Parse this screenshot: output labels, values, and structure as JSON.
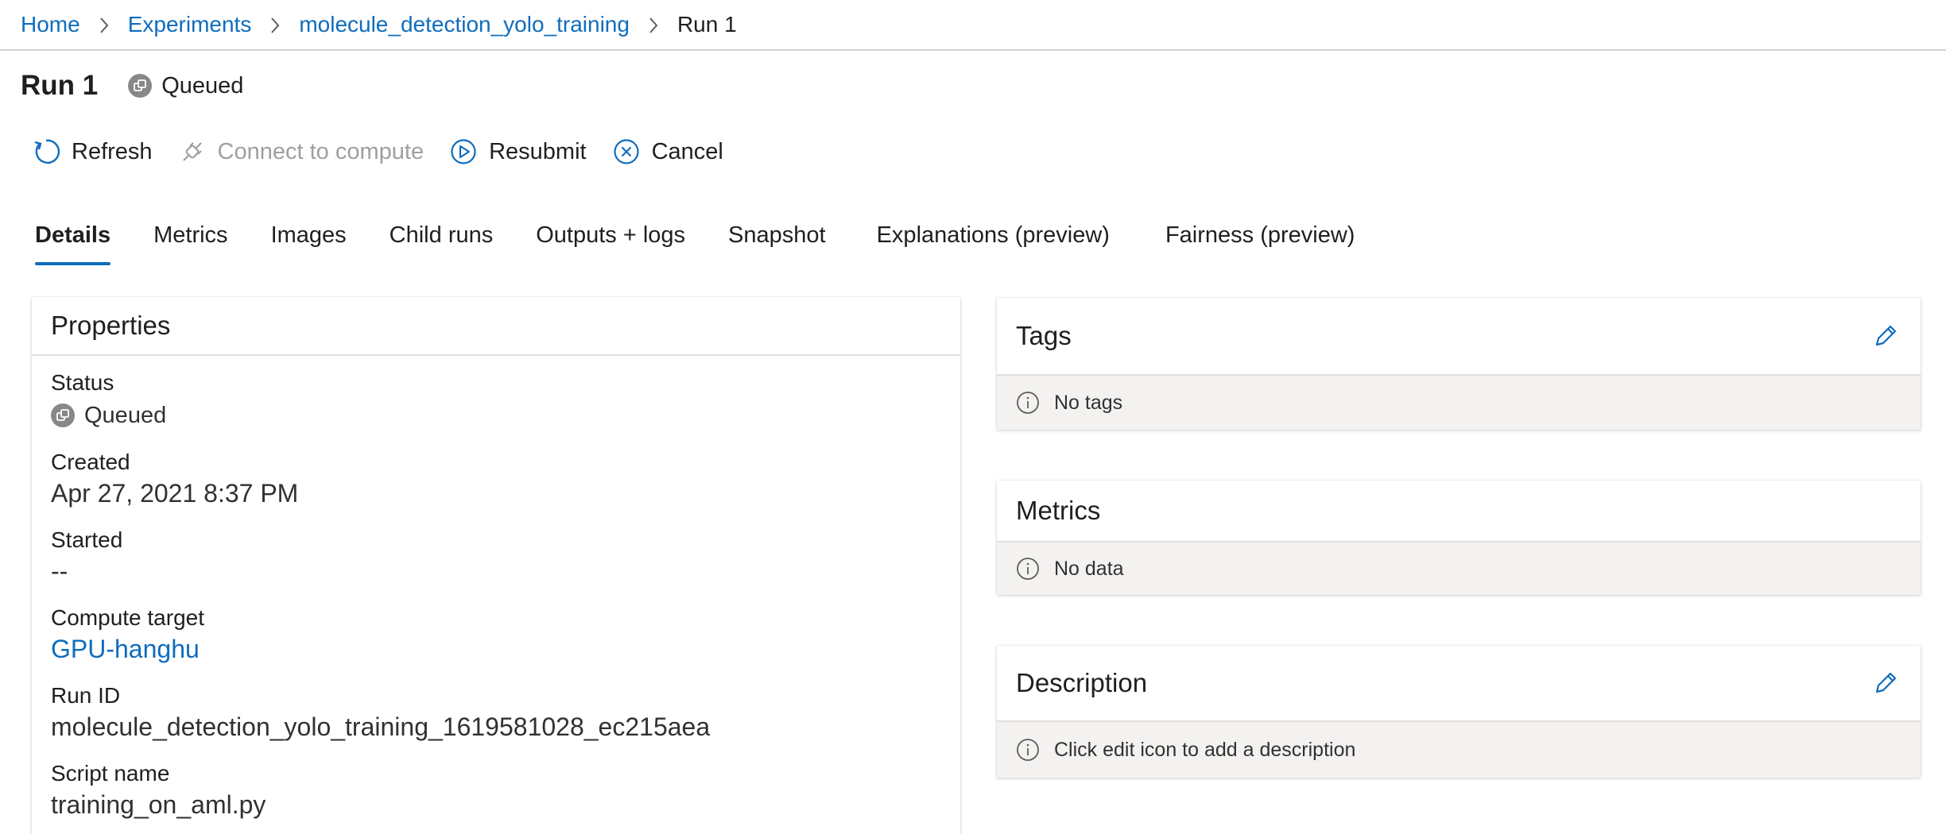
{
  "breadcrumb": {
    "items": [
      "Home",
      "Experiments",
      "molecule_detection_yolo_training"
    ],
    "current": "Run 1"
  },
  "header": {
    "title": "Run 1",
    "status": "Queued"
  },
  "toolbar": {
    "refresh": "Refresh",
    "connect": "Connect to compute",
    "resubmit": "Resubmit",
    "cancel": "Cancel"
  },
  "tabs": [
    "Details",
    "Metrics",
    "Images",
    "Child runs",
    "Outputs + logs",
    "Snapshot",
    "Explanations (preview)",
    "Fairness (preview)"
  ],
  "active_tab": "Details",
  "properties": {
    "title": "Properties",
    "status_label": "Status",
    "status_value": "Queued",
    "created_label": "Created",
    "created_value": "Apr 27, 2021 8:37 PM",
    "started_label": "Started",
    "started_value": "--",
    "compute_label": "Compute target",
    "compute_value": "GPU-hanghu",
    "runid_label": "Run ID",
    "runid_value": "molecule_detection_yolo_training_1619581028_ec215aea",
    "script_label": "Script name",
    "script_value": "training_on_aml.py"
  },
  "tags": {
    "title": "Tags",
    "empty": "No tags"
  },
  "metrics": {
    "title": "Metrics",
    "empty": "No data"
  },
  "description": {
    "title": "Description",
    "empty": "Click edit icon to add a description"
  },
  "colors": {
    "accent": "#0f6cbd",
    "status_gray": "#8a8886",
    "panel_gray": "#f3f2f1"
  }
}
